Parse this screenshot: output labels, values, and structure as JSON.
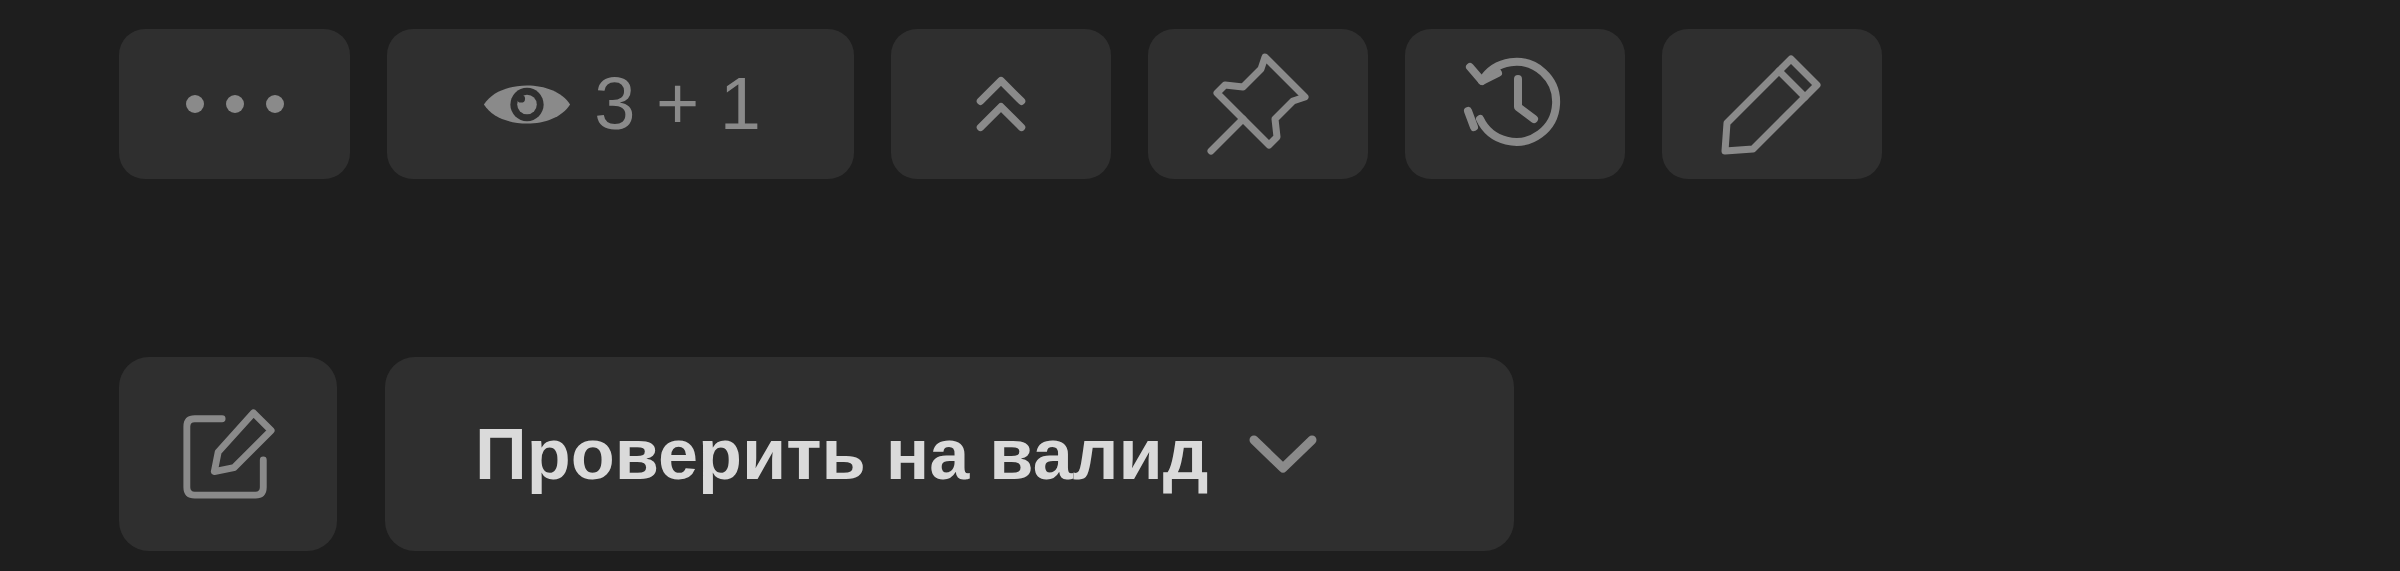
{
  "toolbar": [
    {
      "kind": "more"
    },
    {
      "kind": "watchers",
      "label": "3 + 1"
    },
    {
      "kind": "collapse"
    },
    {
      "kind": "pin"
    },
    {
      "kind": "history"
    },
    {
      "kind": "edit"
    }
  ],
  "actions": [
    {
      "kind": "compose"
    },
    {
      "kind": "dropdown",
      "label": "Проверить на валид"
    }
  ]
}
